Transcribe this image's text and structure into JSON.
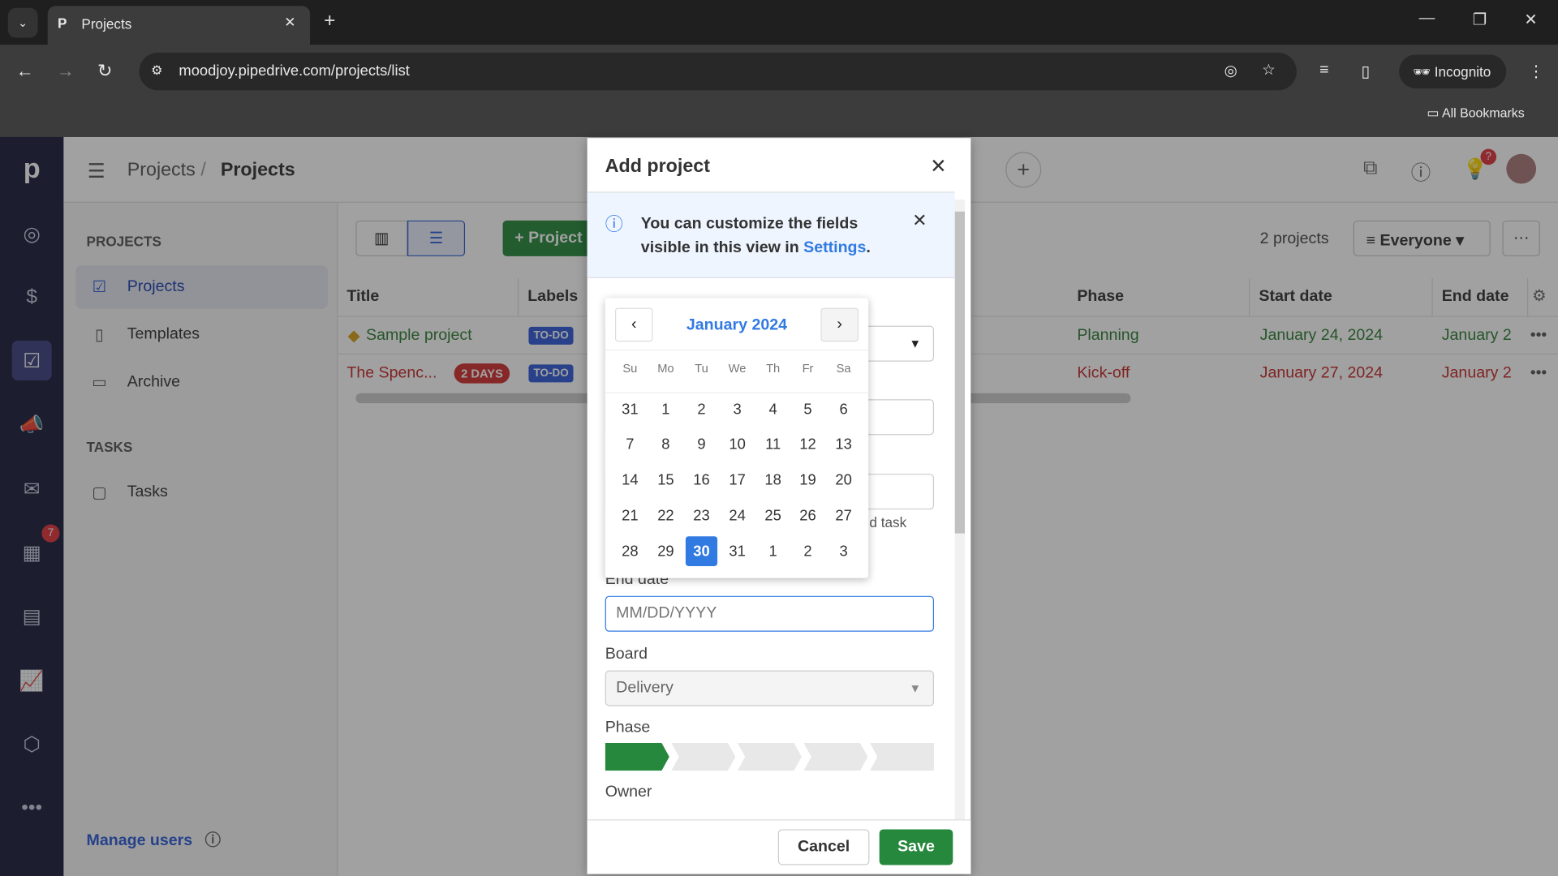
{
  "browser": {
    "tab_title": "Projects",
    "url": "moodjoy.pipedrive.com/projects/list",
    "profile": "Incognito",
    "bookmarks": "All Bookmarks"
  },
  "header": {
    "crumb1": "Projects",
    "sep": "/",
    "crumb2": "Projects"
  },
  "nav": {
    "calendar_badge": "7",
    "help_badge": "?"
  },
  "sidebar": {
    "projects_section": "PROJECTS",
    "items": [
      {
        "label": "Projects"
      },
      {
        "label": "Templates"
      },
      {
        "label": "Archive"
      }
    ],
    "tasks_section": "TASKS",
    "tasks": "Tasks",
    "manage_users": "Manage users"
  },
  "toolbar": {
    "add_project": "+ Project",
    "count": "2 projects",
    "filter": "Everyone",
    "more": "···"
  },
  "table": {
    "columns": [
      "Title",
      "Labels",
      "Phase",
      "Start date",
      "End date"
    ],
    "rows": [
      {
        "title": "Sample project",
        "badge": "",
        "label": "TO-DO",
        "phase": "Planning",
        "start": "January 24, 2024",
        "end": "January 2",
        "color": "#2e7d32"
      },
      {
        "title": "The Spenc...",
        "badge": "2 DAYS",
        "label": "TO-DO",
        "phase": "Kick-off",
        "start": "January 27, 2024",
        "end": "January 2",
        "color": "#c62828"
      }
    ]
  },
  "dialog": {
    "title": "Add project",
    "info_text": "You can customize the fields visible in this view in ",
    "info_link": "Settings",
    "info_end": ".",
    "partial_text": "d task",
    "end_date_label": "End date",
    "end_date_placeholder": "MM/DD/YYYY",
    "board_label": "Board",
    "board_value": "Delivery",
    "phase_label": "Phase",
    "phase_progress": "1 of 5",
    "owner_label": "Owner",
    "cancel": "Cancel",
    "save": "Save"
  },
  "calendar": {
    "month": "January 2024",
    "weekdays": [
      "Su",
      "Mo",
      "Tu",
      "We",
      "Th",
      "Fr",
      "Sa"
    ],
    "days": [
      "31",
      "1",
      "2",
      "3",
      "4",
      "5",
      "6",
      "7",
      "8",
      "9",
      "10",
      "11",
      "12",
      "13",
      "14",
      "15",
      "16",
      "17",
      "18",
      "19",
      "20",
      "21",
      "22",
      "23",
      "24",
      "25",
      "26",
      "27",
      "28",
      "29",
      "30",
      "31",
      "1",
      "2",
      "3"
    ],
    "selected": "30"
  },
  "colors": {
    "accent": "#317ae2",
    "brand_green": "#25883c",
    "nav": "#1b1e3d"
  }
}
